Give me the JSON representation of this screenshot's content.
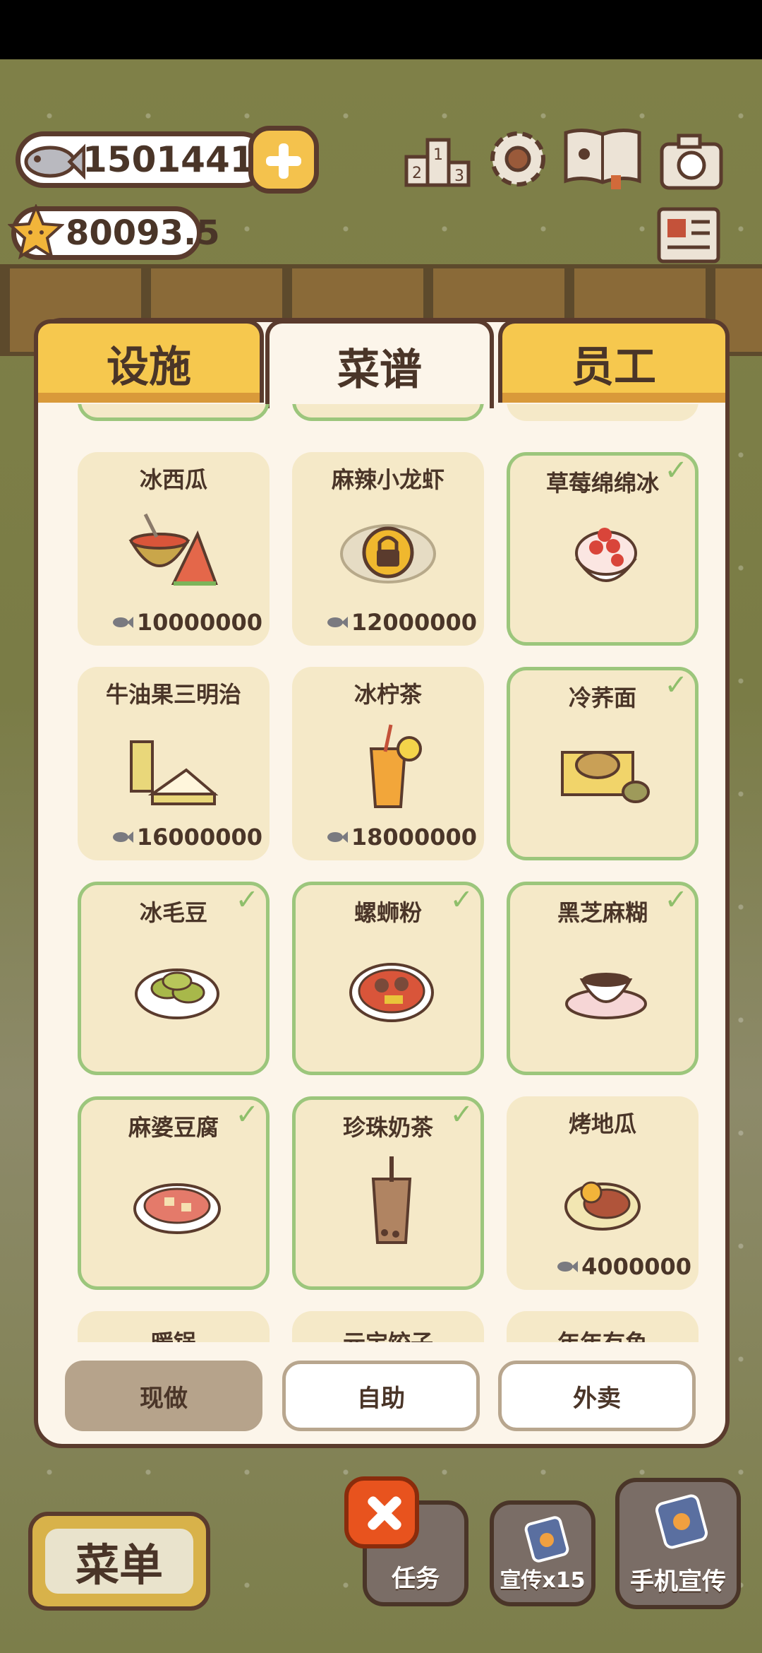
{
  "hud": {
    "fish_count": "1501441",
    "star_count": "80093.5"
  },
  "tabs": [
    {
      "label": "设施",
      "active": false
    },
    {
      "label": "菜谱",
      "active": true
    },
    {
      "label": "员工",
      "active": false
    }
  ],
  "recipes": [
    {
      "name": "冰西瓜",
      "price": "10000000",
      "owned": false,
      "locked": false,
      "icon": "watermelon-icon"
    },
    {
      "name": "麻辣小龙虾",
      "price": "12000000",
      "owned": false,
      "locked": true,
      "icon": "padlock-icon"
    },
    {
      "name": "草莓绵绵冰",
      "price": "",
      "owned": true,
      "locked": false,
      "icon": "strawberry-shaved-ice-icon"
    },
    {
      "name": "牛油果三明治",
      "price": "16000000",
      "owned": false,
      "locked": false,
      "icon": "sandwich-icon"
    },
    {
      "name": "冰柠茶",
      "price": "18000000",
      "owned": false,
      "locked": false,
      "icon": "iced-lemon-tea-icon"
    },
    {
      "name": "冷荞面",
      "price": "",
      "owned": true,
      "locked": false,
      "icon": "cold-soba-icon"
    },
    {
      "name": "冰毛豆",
      "price": "",
      "owned": true,
      "locked": false,
      "icon": "edamame-icon"
    },
    {
      "name": "螺蛳粉",
      "price": "",
      "owned": true,
      "locked": false,
      "icon": "noodle-bowl-icon"
    },
    {
      "name": "黑芝麻糊",
      "price": "",
      "owned": true,
      "locked": false,
      "icon": "sesame-paste-cup-icon"
    },
    {
      "name": "麻婆豆腐",
      "price": "",
      "owned": true,
      "locked": false,
      "icon": "mapo-tofu-icon"
    },
    {
      "name": "珍珠奶茶",
      "price": "",
      "owned": true,
      "locked": false,
      "icon": "bubble-tea-icon"
    },
    {
      "name": "烤地瓜",
      "price": "4000000",
      "owned": false,
      "locked": false,
      "icon": "sweet-potato-icon"
    }
  ],
  "partial_recipes": [
    "暖锅",
    "元宝饺子",
    "年年有鱼"
  ],
  "modes": [
    {
      "label": "现做",
      "selected": true
    },
    {
      "label": "自助",
      "selected": false
    },
    {
      "label": "外卖",
      "selected": false
    }
  ],
  "bottom": {
    "menu_label": "菜单",
    "task_label": "任务",
    "promo_label": "宣传x15",
    "phone_label": "手机宣传"
  },
  "colors": {
    "panel_bg": "#fcf5ea",
    "card_bg": "#f5e9c8",
    "owned_border": "#9cc67c",
    "tab_yellow": "#f6c84e",
    "outline": "#5a3b2d"
  }
}
